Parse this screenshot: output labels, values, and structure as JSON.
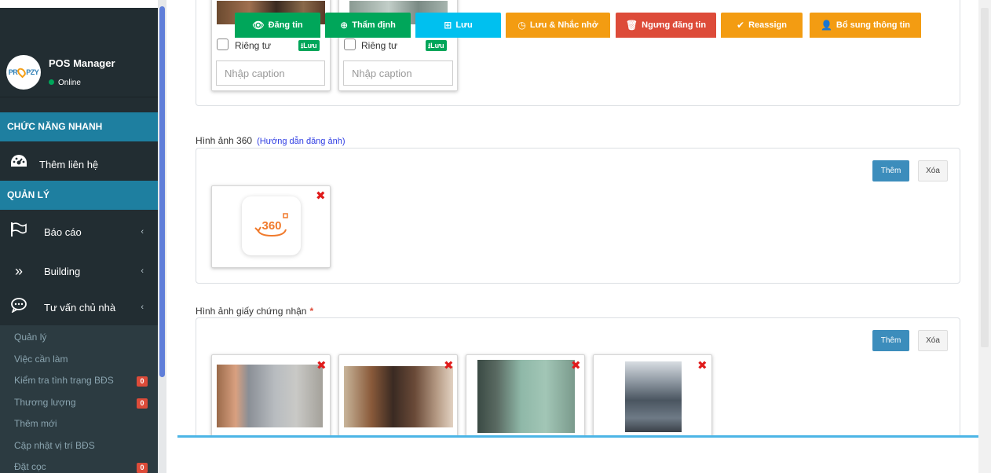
{
  "sidebar": {
    "avatar_text": "PROPZY",
    "user_name": "POS Manager",
    "user_status": "Online",
    "quick_header": "CHỨC NĂNG NHANH",
    "quick_item": "Thêm liên hệ",
    "manage_header": "QUẢN LÝ",
    "menu": [
      {
        "label": "Báo cáo",
        "icon": "flag-icon"
      },
      {
        "label": "Building",
        "icon": "double-chevron-icon"
      },
      {
        "label": "Tư vấn chủ nhà",
        "icon": "chat-icon"
      }
    ],
    "sub_items": [
      {
        "label": "Quản lý",
        "badge": ""
      },
      {
        "label": "Việc cần làm",
        "badge": ""
      },
      {
        "label": "Kiểm tra tình trạng BĐS",
        "badge": "0"
      },
      {
        "label": "Thương lượng",
        "badge": "0"
      },
      {
        "label": "Thêm mới",
        "badge": ""
      },
      {
        "label": "Cập nhật vị trí BĐS",
        "badge": ""
      },
      {
        "label": "Đặt cọc",
        "badge": "0"
      }
    ]
  },
  "photos_top": {
    "cards": [
      {
        "private_label": "Riêng tư",
        "save_label": "Lưu",
        "caption_placeholder": "Nhập caption"
      },
      {
        "private_label": "Riêng tư",
        "save_label": "Lưu",
        "caption_placeholder": "Nhập caption"
      }
    ]
  },
  "section_360": {
    "title": "Hình ảnh 360",
    "guide": "(Hướng dẫn đăng ảnh)",
    "add_label": "Thêm",
    "delete_label": "Xóa",
    "icon_text": "360"
  },
  "section_cert": {
    "title": "Hình ảnh giấy chứng nhận",
    "required_mark": "*",
    "add_label": "Thêm",
    "delete_label": "Xóa"
  },
  "actions": [
    {
      "label": "Đăng tin",
      "glyph": "eye-icon",
      "color": "#00a65a"
    },
    {
      "label": "Thẩm định",
      "glyph": "search-plus-icon",
      "color": "#00a65a"
    },
    {
      "label": "Lưu",
      "glyph": "sitemap-icon",
      "color": "#00c0ef"
    },
    {
      "label": "Lưu & Nhắc nhở",
      "glyph": "clock-icon",
      "color": "#f39c12"
    },
    {
      "label": "Ngưng đăng tin",
      "glyph": "trash-icon",
      "color": "#dd4b39"
    },
    {
      "label": "Reassign",
      "glyph": "check-icon",
      "color": "#f39c12"
    },
    {
      "label": "Bổ sung thông tin",
      "glyph": "user-icon",
      "color": "#f39c12"
    }
  ]
}
